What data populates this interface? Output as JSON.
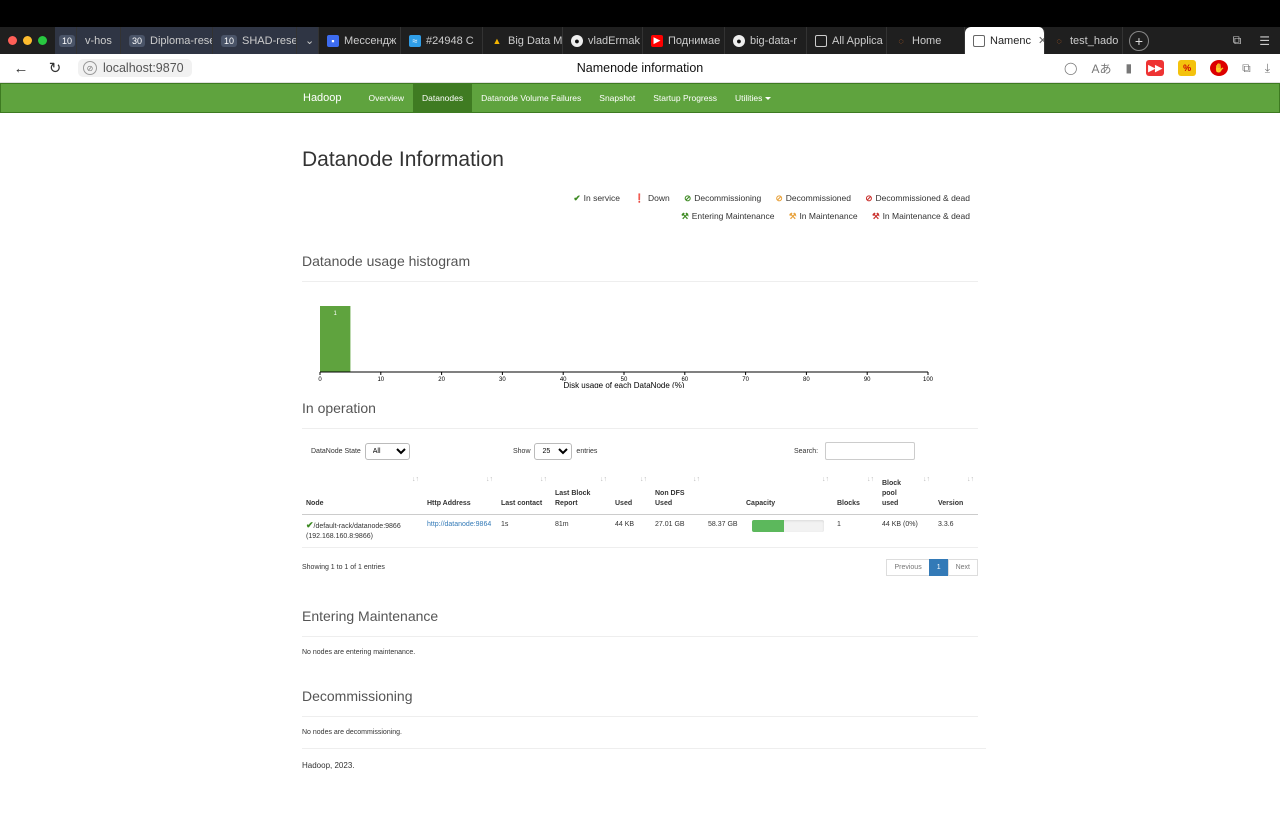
{
  "browser": {
    "tabs": [
      {
        "label": "10",
        "kind": "badge"
      },
      {
        "label": "v-hos",
        "kind": "group"
      },
      {
        "label": "Diploma-resear",
        "badge": "30",
        "kind": "group"
      },
      {
        "label": "SHAD-resea",
        "badge": "10",
        "kind": "group"
      },
      {
        "label": "Мессендж",
        "icon": "chat-icon"
      },
      {
        "label": "#24948 C",
        "icon": "wave-icon"
      },
      {
        "label": "Big Data M",
        "icon": "drive-icon"
      },
      {
        "label": "vladErmak",
        "icon": "github-icon"
      },
      {
        "label": "Поднимае",
        "icon": "youtube-icon"
      },
      {
        "label": "big-data-r",
        "icon": "github-icon"
      },
      {
        "label": "All Applica",
        "icon": "page-icon"
      },
      {
        "label": "Home",
        "icon": "jupyter-icon"
      },
      {
        "label": "Namenc",
        "icon": "page-icon",
        "active": true
      },
      {
        "label": "test_hado",
        "icon": "jupyter-icon"
      }
    ],
    "url": "localhost:9870",
    "page_title": "Namenode information"
  },
  "navbar": {
    "brand": "Hadoop",
    "items": [
      {
        "label": "Overview"
      },
      {
        "label": "Datanodes",
        "active": true
      },
      {
        "label": "Datanode Volume Failures"
      },
      {
        "label": "Snapshot"
      },
      {
        "label": "Startup Progress"
      },
      {
        "label": "Utilities"
      }
    ]
  },
  "page": {
    "heading": "Datanode Information",
    "legend": {
      "in_service": "In service",
      "down": "Down",
      "decommissioning": "Decommissioning",
      "decommissioned": "Decommissioned",
      "decommissioned_dead": "Decommissioned & dead",
      "entering_maintenance": "Entering Maintenance",
      "in_maintenance": "In Maintenance",
      "in_maintenance_dead": "In Maintenance & dead"
    }
  },
  "histogram": {
    "title": "Datanode usage histogram",
    "chart_data": {
      "type": "bar",
      "xlabel": "Disk usage of each DataNode (%)",
      "xlim": [
        0,
        100
      ],
      "xticks": [
        0,
        10,
        20,
        30,
        40,
        50,
        60,
        70,
        80,
        90,
        100
      ],
      "bins": [
        {
          "x0": 0,
          "x1": 5,
          "value": 1
        }
      ],
      "bar_color": "#5fa33e"
    }
  },
  "in_operation": {
    "title": "In operation",
    "state_label": "DataNode State",
    "state_value": "All",
    "show_label": "Show",
    "show_value": "25",
    "entries_label": "entries",
    "search_label": "Search:",
    "columns": [
      "Node",
      "Http Address",
      "Last contact",
      "Last Block Report",
      "Used",
      "Non DFS Used",
      "",
      "Capacity",
      "Blocks",
      "Block pool used",
      "Version"
    ],
    "rows": [
      {
        "node": "/default-rack/datanode:9866",
        "node_ip": "(192.168.160.8:9866)",
        "http": "http://datanode:9864",
        "last_contact": "1s",
        "last_block_report": "81m",
        "used": "44 KB",
        "non_dfs_used": "27.01 GB",
        "remaining": "58.37 GB",
        "capacity_pct": 45,
        "blocks": "1",
        "block_pool_used": "44 KB (0%)",
        "version": "3.3.6"
      }
    ],
    "info": "Showing 1 to 1 of 1 entries",
    "pager": {
      "prev": "Previous",
      "current": "1",
      "next": "Next"
    }
  },
  "entering_maintenance": {
    "title": "Entering Maintenance",
    "note": "No nodes are entering maintenance."
  },
  "decommissioning": {
    "title": "Decommissioning",
    "note": "No nodes are decommissioning."
  },
  "footer": "Hadoop, 2023."
}
